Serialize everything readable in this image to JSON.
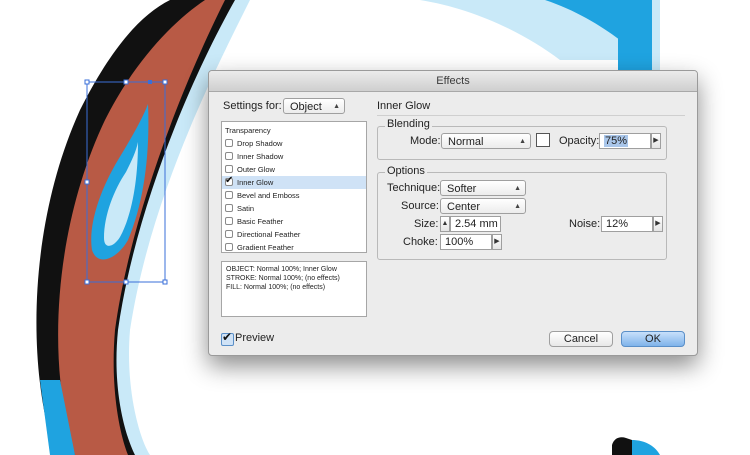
{
  "dialog": {
    "title": "Effects",
    "settings_for_label": "Settings for:",
    "settings_for_value": "Object",
    "section_title": "Inner Glow",
    "effects_list": {
      "header": "Transparency",
      "items": [
        {
          "label": "Drop Shadow",
          "checked": false,
          "selected": false
        },
        {
          "label": "Inner Shadow",
          "checked": false,
          "selected": false
        },
        {
          "label": "Outer Glow",
          "checked": false,
          "selected": false
        },
        {
          "label": "Inner Glow",
          "checked": true,
          "selected": true
        },
        {
          "label": "Bevel and Emboss",
          "checked": false,
          "selected": false
        },
        {
          "label": "Satin",
          "checked": false,
          "selected": false
        },
        {
          "label": "Basic Feather",
          "checked": false,
          "selected": false
        },
        {
          "label": "Directional Feather",
          "checked": false,
          "selected": false
        },
        {
          "label": "Gradient Feather",
          "checked": false,
          "selected": false
        }
      ]
    },
    "summary": [
      "OBJECT: Normal 100%; Inner Glow",
      "STROKE: Normal 100%; (no effects)",
      "FILL: Normal 100%; (no effects)"
    ],
    "blending": {
      "title": "Blending",
      "mode_label": "Mode:",
      "mode_value": "Normal",
      "opacity_label": "Opacity:",
      "opacity_value": "75%",
      "swatch_color": "#ffffff"
    },
    "options": {
      "title": "Options",
      "technique_label": "Technique:",
      "technique_value": "Softer",
      "source_label": "Source:",
      "source_value": "Center",
      "size_label": "Size:",
      "size_value": "2.54 mm",
      "noise_label": "Noise:",
      "noise_value": "12%",
      "choke_label": "Choke:",
      "choke_value": "100%"
    },
    "preview_label": "Preview",
    "preview_checked": true,
    "cancel_label": "Cancel",
    "ok_label": "OK"
  },
  "colors": {
    "artwork_fill": "#b85a45",
    "artwork_stroke": "#111111",
    "artwork_highlight": "#1fa3e0",
    "artwork_light": "#c9e9f8",
    "selection": "#3a6fd8"
  }
}
